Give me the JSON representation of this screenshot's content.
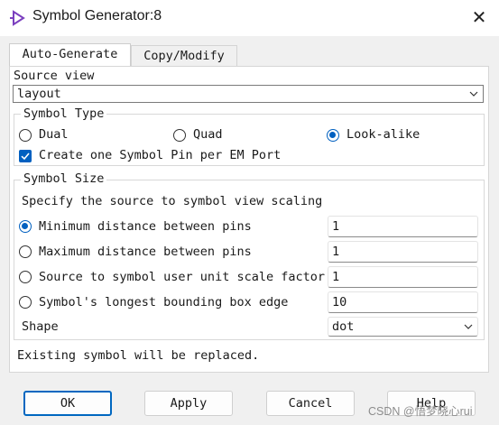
{
  "window": {
    "title": "Symbol Generator:8"
  },
  "tabs": [
    {
      "label": "Auto-Generate",
      "active": true
    },
    {
      "label": "Copy/Modify",
      "active": false
    }
  ],
  "source_view": {
    "label": "Source view",
    "value": "layout"
  },
  "symbol_type": {
    "legend": "Symbol Type",
    "options": [
      {
        "label": "Dual",
        "selected": false
      },
      {
        "label": "Quad",
        "selected": false
      },
      {
        "label": "Look-alike",
        "selected": true
      }
    ],
    "one_pin_per_port": {
      "label": "Create one Symbol Pin per EM Port",
      "checked": true
    }
  },
  "symbol_size": {
    "legend": "Symbol Size",
    "instruction": "Specify the source to symbol view scaling",
    "options": [
      {
        "label": "Minimum distance between pins",
        "value": "1",
        "selected": true
      },
      {
        "label": "Maximum distance between pins",
        "value": "1",
        "selected": false
      },
      {
        "label": "Source to symbol user unit scale factor",
        "value": "1",
        "selected": false
      },
      {
        "label": "Symbol's longest bounding box edge",
        "value": "10",
        "selected": false
      }
    ],
    "shape": {
      "label": "Shape",
      "value": "dot"
    }
  },
  "status": "Existing symbol will be replaced.",
  "buttons": {
    "ok": "OK",
    "apply": "Apply",
    "cancel": "Cancel",
    "help": "Help"
  },
  "watermark": "CSDN @悟梦晓心rui",
  "colors": {
    "accent": "#0060c0",
    "app_icon": "#7b3fbf"
  }
}
